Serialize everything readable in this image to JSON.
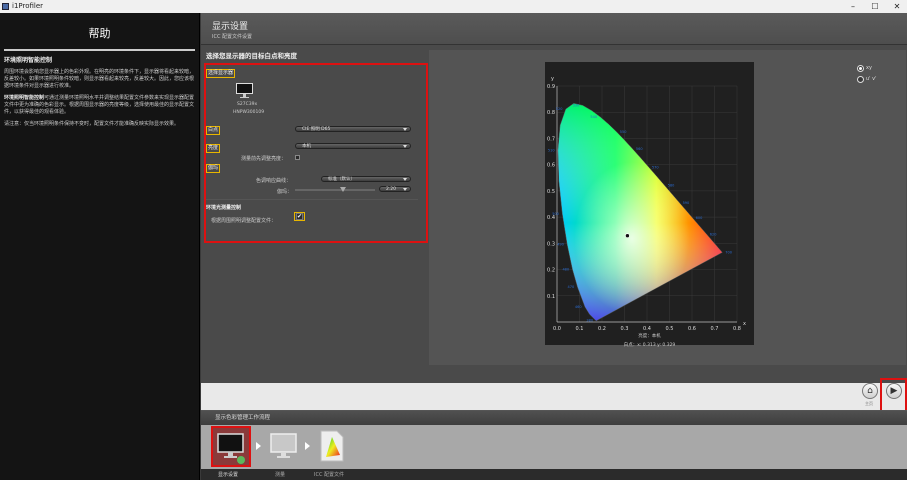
{
  "window": {
    "title": "i1Profiler",
    "minimize": "–",
    "maximize": "☐",
    "close": "✕"
  },
  "help": {
    "title": "帮助",
    "subtitle": "环境照明智能控制",
    "para1": "周围环境会影响您显示器上的色彩外观。在明亮的环境条件下，显示器将看起来较暗，反差较小。如果环境照明条件较暗，则显示器看起来较亮，反差较大。因此，您应该根据环境条件对显示器进行校准。",
    "para2_bold": "环境照明智能控制",
    "para2": "可通过测量环境照明水平并调整结果配置文件参数来实现显示器配置文件中更为准确的色彩显示。根据周围显示器的亮度等级，选择使用最佳的显示配置文件，以获得最佳的观看体验。",
    "para3": "请注意：仅当环境照明条件保持不变时，配置文件才能准确反映实际显示效果。"
  },
  "header": {
    "title": "显示设置",
    "subtitle": "ICC 配置文件设置"
  },
  "settings": {
    "section_title": "选择您显示器的目标白点和亮度",
    "select_display": "选择显示器",
    "monitor_name": "S27C39x",
    "monitor_serial": "HNPW300109",
    "white_point_label": "白点",
    "white_point_value": "CIE 照明 D65",
    "luminance_label": "亮度",
    "luminance_value": "本机",
    "measure_before": "测量前先调整亮度：",
    "gamma_label": "伽玛",
    "tone_response_label": "色调响应曲线：",
    "tone_response_value": "标准（默认）",
    "gamma_value_label": "伽玛：",
    "gamma_value": "2.20",
    "ambient_title": "环境光测量控制",
    "ambient_label": "根据周围照明调整配置文件：",
    "ambient_checked": "✔"
  },
  "radios": [
    {
      "label": "xy",
      "selected": true
    },
    {
      "label": "u' v'",
      "selected": false
    }
  ],
  "chart_data": {
    "type": "scatter",
    "title": "",
    "xlabel": "x",
    "ylabel": "y",
    "xlim": [
      0,
      0.8
    ],
    "ylim": [
      0,
      0.9
    ],
    "xticks": [
      "0.0",
      "0.1",
      "0.2",
      "0.3",
      "0.4",
      "0.5",
      "0.6",
      "0.7",
      "0.8"
    ],
    "yticks": [
      "0.1",
      "0.2",
      "0.3",
      "0.4",
      "0.5",
      "0.6",
      "0.7",
      "0.8",
      "0.9"
    ],
    "x_axis_letter": "x",
    "y_axis_letter": "y",
    "white_point": {
      "x": 0.313,
      "y": 0.329
    },
    "luminance_text": "亮度：本机",
    "white_text": "白点：x: 0.313  y: 0.329",
    "series": [
      {
        "points": [
          [
            0.175,
            0.005
          ],
          [
            0.1736,
            0.0049
          ],
          [
            0.144,
            0.03
          ],
          [
            0.1241,
            0.0578
          ],
          [
            0.0913,
            0.1327
          ],
          [
            0.0687,
            0.2007
          ],
          [
            0.0454,
            0.295
          ],
          [
            0.0235,
            0.4127
          ],
          [
            0.0082,
            0.5384
          ],
          [
            0.0039,
            0.6548
          ],
          [
            0.0139,
            0.7502
          ],
          [
            0.0389,
            0.812
          ],
          [
            0.0743,
            0.8338
          ],
          [
            0.1142,
            0.8262
          ],
          [
            0.1547,
            0.8059
          ],
          [
            0.1929,
            0.7816
          ],
          [
            0.2296,
            0.7543
          ],
          [
            0.2658,
            0.7243
          ],
          [
            0.3016,
            0.6923
          ],
          [
            0.3373,
            0.6589
          ],
          [
            0.3731,
            0.6245
          ],
          [
            0.4087,
            0.5896
          ],
          [
            0.4441,
            0.5547
          ],
          [
            0.4788,
            0.5202
          ],
          [
            0.5125,
            0.4866
          ],
          [
            0.5448,
            0.4544
          ],
          [
            0.5752,
            0.4242
          ],
          [
            0.6029,
            0.3965
          ],
          [
            0.627,
            0.3725
          ],
          [
            0.6482,
            0.3514
          ],
          [
            0.6658,
            0.334
          ],
          [
            0.6801,
            0.3197
          ],
          [
            0.6915,
            0.3083
          ],
          [
            0.7006,
            0.2993
          ],
          [
            0.7079,
            0.292
          ],
          [
            0.714,
            0.2859
          ],
          [
            0.719,
            0.2809
          ],
          [
            0.723,
            0.277
          ],
          [
            0.726,
            0.274
          ],
          [
            0.7347,
            0.2653
          ]
        ]
      }
    ],
    "wavelength_labels": [
      "380",
      "460",
      "470",
      "480",
      "490",
      "500",
      "510",
      "520",
      "530",
      "540",
      "550",
      "560",
      "570",
      "580",
      "590",
      "600",
      "620",
      "700"
    ]
  },
  "nav": {
    "home_icon": "⌂",
    "next_icon": "▶",
    "home_label": "主页",
    "next_label": "下一步"
  },
  "workflow": {
    "title": "显示色彩管理工作流程",
    "steps": [
      "显示设置",
      "测量",
      "ICC 配置文件"
    ]
  }
}
